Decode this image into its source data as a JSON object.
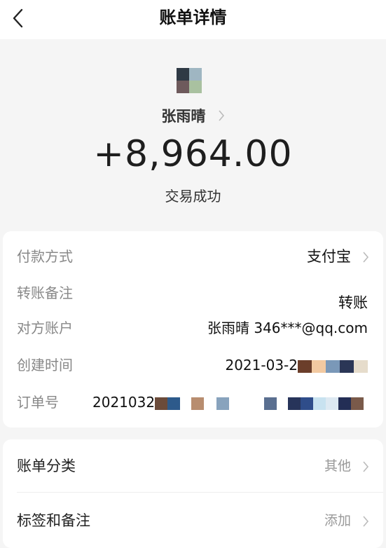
{
  "nav": {
    "title": "账单详情"
  },
  "header": {
    "payee": "张雨晴",
    "amount": "+8,964.00",
    "status": "交易成功"
  },
  "details": [
    {
      "label": "付款方式",
      "value": "支付宝",
      "chevron": true
    },
    {
      "label": "转账备注",
      "value": "转账"
    },
    {
      "label": "对方账户",
      "value": "张雨晴 346***@qq.com"
    },
    {
      "label": "创建时间",
      "value": "2021-03-2"
    },
    {
      "label": "订单号",
      "value": "2021032"
    }
  ],
  "extras": [
    {
      "label": "账单分类",
      "value": "其他"
    },
    {
      "label": "标签和备注",
      "value": "添加"
    }
  ],
  "colors": {
    "avatar": [
      "#2f3a45",
      "#9fb6c2",
      "#6e5a5c",
      "#a9c1a0"
    ],
    "mosaic_time": [
      "#6b3e2a",
      "#f2c9a1",
      "#7a98b8",
      "#2b3656",
      "#e6dccb"
    ],
    "mosaic_order": [
      "#6b4b3a",
      "#2d5a8b",
      "#b88d6f",
      "#88a3bd",
      "#5a6f90",
      "#27345a",
      "#2f4d8a",
      "#c8e2f0",
      "#dde9f2",
      "#232e55",
      "#7a5a4a"
    ]
  }
}
